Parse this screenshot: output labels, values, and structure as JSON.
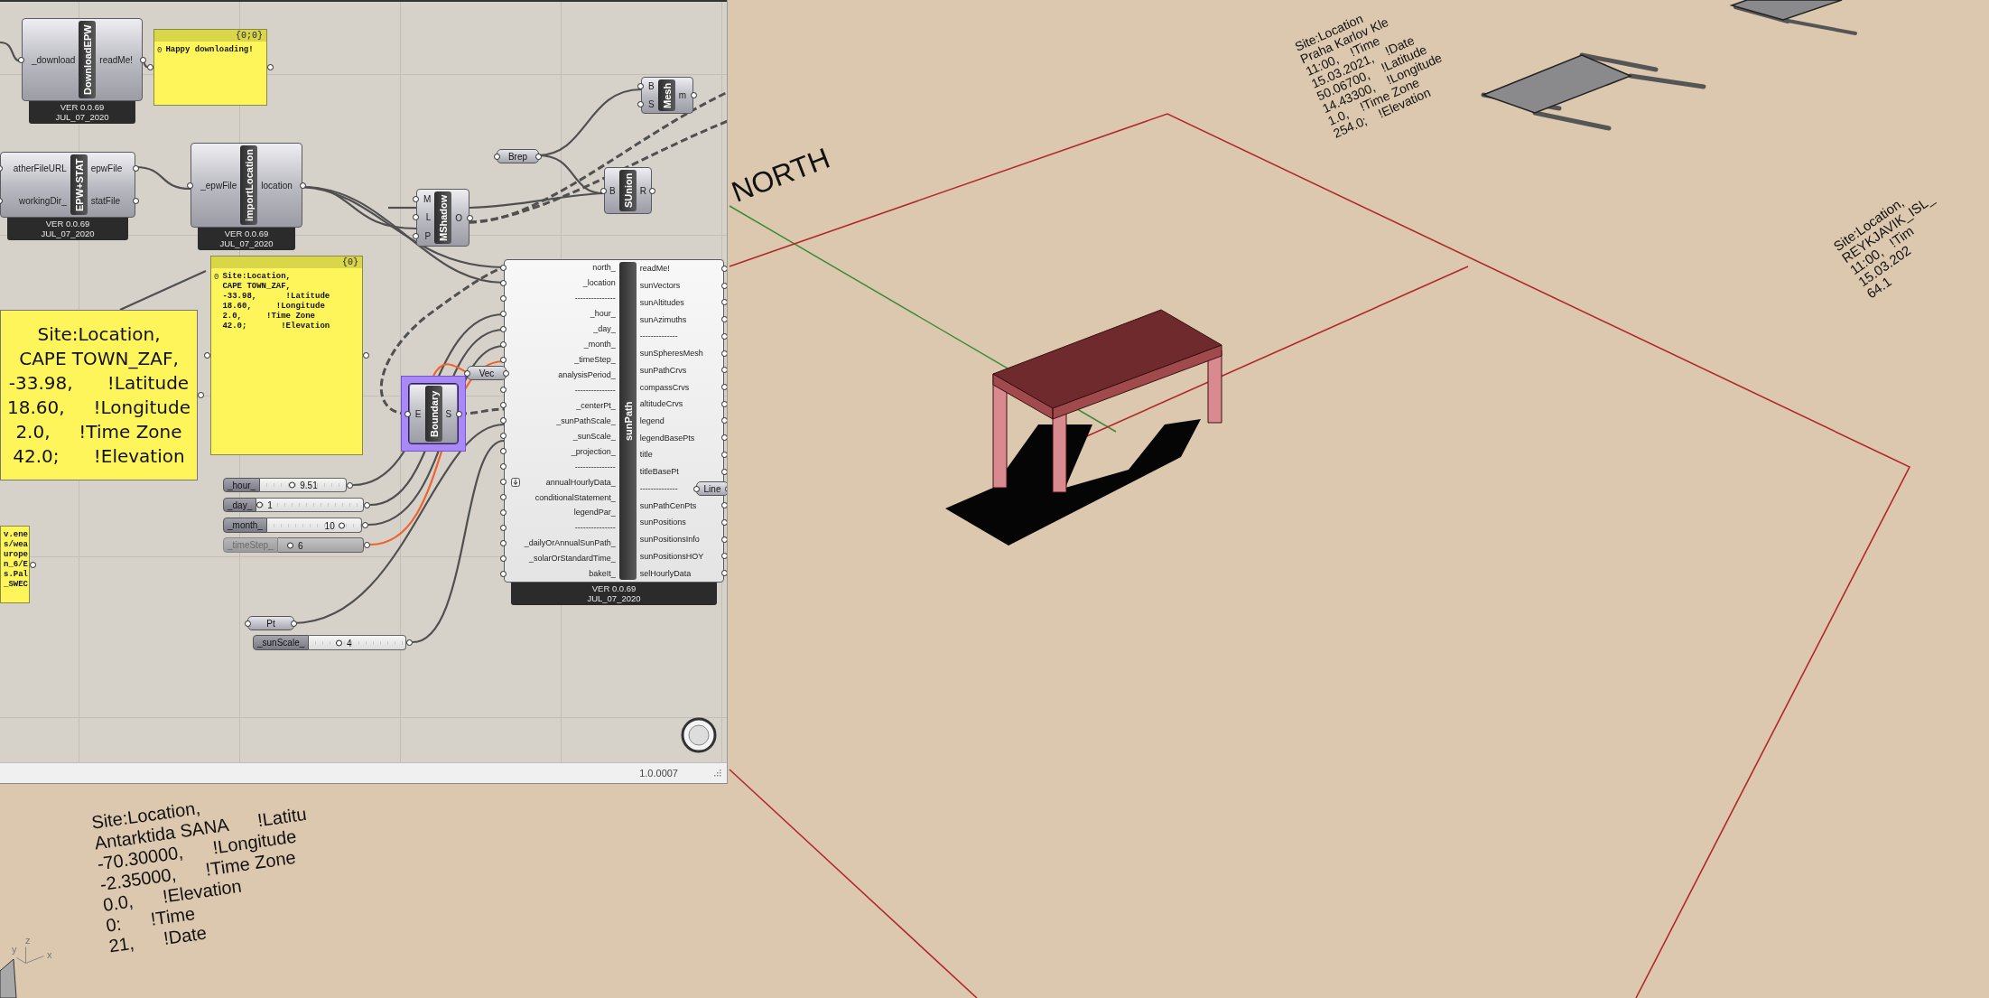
{
  "editor": {
    "components": [
      {
        "title": "DownloadEPW",
        "inputs": [
          "_download"
        ],
        "outputs": [
          "readMe!"
        ],
        "version": "VER 0.0.69",
        "date": "JUL_07_2020",
        "selected": false
      },
      {
        "title": "EPW+STAT",
        "inputs": [
          "atherFileURL",
          "workingDir_"
        ],
        "outputs": [
          "epwFile",
          "statFile"
        ],
        "version": "VER 0.0.69",
        "date": "JUL_07_2020",
        "selected": false
      },
      {
        "title": "importLocation",
        "inputs": [
          "_epwFile"
        ],
        "outputs": [
          "location"
        ],
        "version": "VER 0.0.69",
        "date": "JUL_07_2020",
        "selected": false
      },
      {
        "title": "MShadow",
        "inputs": [
          "M",
          "L",
          "P"
        ],
        "outputs": [
          "O"
        ],
        "selected": false
      },
      {
        "title": "Mesh",
        "inputs": [
          "B",
          "S"
        ],
        "outputs": [
          "m"
        ],
        "selected": false
      },
      {
        "title": "SUnion",
        "inputs": [
          "B"
        ],
        "outputs": [
          "R"
        ],
        "selected": false
      },
      {
        "title": "Boundary",
        "inputs": [
          "E"
        ],
        "outputs": [
          "S"
        ],
        "selected": true
      },
      {
        "title": "sunPath",
        "inputs": [
          {
            "label": "north_",
            "kind": "plain"
          },
          {
            "label": "_location",
            "kind": "plain"
          },
          {
            "label": "---------------",
            "kind": "plain"
          },
          {
            "label": "_hour_",
            "kind": "plain"
          },
          {
            "label": "_day_",
            "kind": "plain"
          },
          {
            "label": "_month_",
            "kind": "plain"
          },
          {
            "label": "_timeStep_",
            "kind": "plain"
          },
          {
            "label": "analysisPeriod_",
            "kind": "plain"
          },
          {
            "label": "---------------",
            "kind": "plain"
          },
          {
            "label": "_centerPt_",
            "kind": "plain"
          },
          {
            "label": "_sunPathScale_",
            "kind": "plain"
          },
          {
            "label": "_sunScale_",
            "kind": "plain"
          },
          {
            "label": "_projection_",
            "kind": "plain"
          },
          {
            "label": "---------------",
            "kind": "plain"
          },
          {
            "label": "annualHourlyData_",
            "kind": "flatten"
          },
          {
            "label": "conditionalStatement_",
            "kind": "plain"
          },
          {
            "label": "legendPar_",
            "kind": "plain"
          },
          {
            "label": "---------------",
            "kind": "plain"
          },
          {
            "label": "_dailyOrAnnualSunPath_",
            "kind": "plain"
          },
          {
            "label": "_solarOrStandardTime_",
            "kind": "plain"
          },
          {
            "label": "bakeIt_",
            "kind": "plain"
          }
        ],
        "outputs": [
          "readMe!",
          "sunVectors",
          "sunAltitudes",
          "sunAzimuths",
          "--------------",
          "sunSpheresMesh",
          "sunPathCrvs",
          "compassCrvs",
          "altitudeCrvs",
          "legend",
          "legendBasePts",
          "title",
          "titleBasePt",
          "--------------",
          "sunPathCenPts",
          "sunPositions",
          "sunPositionsInfo",
          "sunPositionsHOY",
          "selHourlyData"
        ],
        "version": "VER 0.0.69",
        "date": "JUL_07_2020",
        "selected": false
      }
    ],
    "panels": [
      {
        "kind": "data",
        "header": "{0;0}",
        "index": "0",
        "lines": [
          "Happy downloading!"
        ]
      },
      {
        "kind": "data",
        "header": "{0}",
        "index": "0",
        "lines": [
          "Site:Location,",
          "CAPE TOWN_ZAF,",
          "-33.98,      !Latitude",
          "18.60,     !Longitude",
          "2.0,     !Time Zone",
          "42.0;       !Elevation"
        ]
      },
      {
        "kind": "note",
        "lines": [
          "Site:Location,",
          "CAPE TOWN_ZAF,",
          "-33.98,      !Latitude",
          "18.60,     !Longitude",
          "2.0,     !Time Zone",
          "42.0;      !Elevation"
        ]
      },
      {
        "kind": "data",
        "lines": [
          "v.ene",
          "s/wea",
          "urope",
          "n_6/E",
          "s.Pal",
          "_SWEC"
        ]
      }
    ],
    "params": [
      {
        "label": "Brep"
      },
      {
        "label": "Vec"
      },
      {
        "label": "Pt"
      },
      {
        "label": "Line"
      }
    ],
    "sliders": [
      {
        "label": "_hour_",
        "value": "9.51",
        "level": 0.37,
        "disabled": false
      },
      {
        "label": "_day_",
        "value": "1",
        "level": 0.0,
        "disabled": false
      },
      {
        "label": "_month_",
        "value": "10",
        "level": 0.82,
        "disabled": false
      },
      {
        "label": "_timeStep_",
        "value": "6",
        "level": 0.12,
        "disabled": true
      },
      {
        "label": "_sunScale_",
        "value": "4",
        "level": 0.3,
        "disabled": false
      }
    ],
    "version": "1.0.0007"
  },
  "viewport": {
    "north_label": "NORTH",
    "axis_labels": [
      "y",
      "z",
      "x"
    ],
    "annotations": [
      {
        "lines": [
          "Site:Location",
          "Praha Karlov Kle",
          "11:00,    !Time",
          "15.03.2021,    !Date",
          "50.06700,    !Latitude",
          "14.43300,    !Longitude",
          "1.0,    !Time Zone",
          "254.0;    !Elevation"
        ]
      },
      {
        "lines": [
          "Site:Location,",
          "REYKJAVIK_ISL_",
          "11:00,   !Tim",
          "15.03.202",
          "64.1"
        ]
      },
      {
        "lines": [
          "Site:Location,",
          "Antarktida SANA      !Latitu",
          "-70.30000,      !Longitude",
          "-2.35000,      !Time Zone",
          "0.0,      !Elevation",
          "0:      !Time",
          "21,      !Date"
        ]
      }
    ]
  }
}
